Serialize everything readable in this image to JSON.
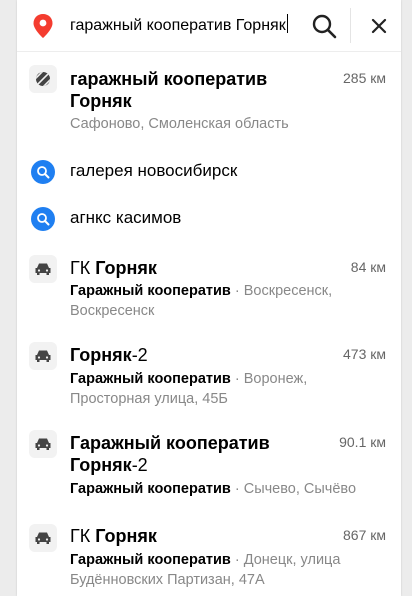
{
  "search": {
    "query": "гаражный кооператив Горняк"
  },
  "icons": {
    "pin": "map-pin-icon",
    "search": "search-icon",
    "close": "close-icon",
    "history": "history-search-icon",
    "garage": "garage-car-icon",
    "cooperative": "striped-circle-icon"
  },
  "colors": {
    "pin_red": "#f43c2f",
    "history_blue": "#1f7ff1",
    "muted_text": "#888888"
  },
  "results": [
    {
      "title_line1": "гаражный кооператив",
      "title_line2": "Горняк",
      "distance": "285 км",
      "address": "Сафоново, Смоленская область"
    },
    {
      "history_text": "галерея новосибирск"
    },
    {
      "history_text": "агнкс касимов"
    },
    {
      "title_prefix": "ГК ",
      "title_bold": "Горняк",
      "distance": "84 км",
      "category": "Гаражный кооператив",
      "separator": " · ",
      "address_line1": "Воскресенск,",
      "address_line2": "Воскресенск"
    },
    {
      "title_bold": "Горняк",
      "title_suffix": "-2",
      "distance": "473 км",
      "category": "Гаражный кооператив",
      "separator": " · ",
      "address_line1": "Воронеж,",
      "address_line2": "Просторная улица, 45Б"
    },
    {
      "title_line1": "Гаражный кооператив",
      "title_bold": "Горняк",
      "title_suffix": "-2",
      "distance": "90.1 км",
      "category": "Гаражный кооператив",
      "separator": " · ",
      "address_line1": "Сычево, Сычёво"
    },
    {
      "title_prefix": "ГК ",
      "title_bold": "Горняк",
      "distance": "867 км",
      "category": "Гаражный кооператив",
      "separator": " · ",
      "address_line1": "Донецк, улица",
      "address_line2": "Будённовских Партизан, 47А"
    }
  ]
}
